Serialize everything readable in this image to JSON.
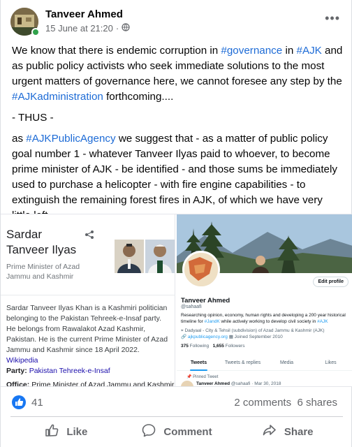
{
  "post": {
    "author": "Tanveer Ahmed",
    "timestamp": "15 June at 21:20",
    "privacy_icon": "globe-icon",
    "more_icon": "more-options-icon",
    "paragraph1": {
      "t1": "We know that there is endemic corruption in ",
      "tag1": "#governance",
      "t2": " in ",
      "tag2": "#AJK",
      "t3": " and as public policy activists who seek immediate solutions to the most urgent matters of governance here, we cannot foresee any step by the ",
      "tag3": "#AJKadministration",
      "t4": " forthcoming...."
    },
    "paragraph2": "- THUS -",
    "paragraph3": {
      "t1": "as ",
      "tag1": "#AJKPublicAgency",
      "t2": " we suggest that - as a matter of public policy goal number 1 - whatever Tanveer Ilyas paid to whoever, to become prime minister of AJK - be identified - and those sums be immediately used to purchase a helicopter - with fire engine capabilities - to extinguish the remaining forest fires in AJK, of which we have very little left."
    }
  },
  "knowledge_panel": {
    "name": "Sardar Tanveer Ilyas",
    "subtitle": "Prime Minister of Azad Jammu and Kashmir",
    "description": "Sardar Tanveer Ilyas Khan is a Kashmiri politician belonging to the Pakistan Tehreek-e-Insaf party. He belongs from Rawalakot Azad Kashmir, Pakistan. He is the current Prime Minister of Azad Jammu and Kashmir since 18 April 2022.",
    "source_link": "Wikipedia",
    "party_label": "Party:",
    "party_value": "Pakistan Tehreek-e-Insaf",
    "office_label": "Office:",
    "office_value": "Prime Minister of Azad Jammu and Kashmir"
  },
  "twitter_profile": {
    "name": "Tanveer Ahmed",
    "handle": "@sahaafi",
    "edit_button": "Edit profile",
    "bio_t1": "Researching opinion, economy, human rights and developing a 200 year historical timeline for ",
    "bio_tag": "#JandK",
    "bio_t2": " while actively working to develop civil society in ",
    "bio_tag2": "#AJK",
    "location": "Dadyaal - City & Tehsil (subdivision) of Azad Jammu & Kashmir (AJK)",
    "website": "ajkpublicagency.org",
    "joined": "Joined September 2010",
    "following_count": "375",
    "following_label": "Following",
    "followers_count": "1,655",
    "followers_label": "Followers",
    "tabs": [
      "Tweets",
      "Tweets & replies",
      "Media",
      "Likes"
    ],
    "pinned_label": "Pinned Tweet",
    "tweet_author": "Tanveer Ahmed",
    "tweet_meta": "@sahaafi · Mar 30, 2018"
  },
  "stats": {
    "likes": "41",
    "comments": "2 comments",
    "shares": "6 shares"
  },
  "actions": {
    "like": "Like",
    "comment": "Comment",
    "share": "Share"
  },
  "colors": {
    "facebook_blue": "#1877f2",
    "hashtag": "#1d6bd6",
    "twitter_blue": "#1d9bf0"
  }
}
